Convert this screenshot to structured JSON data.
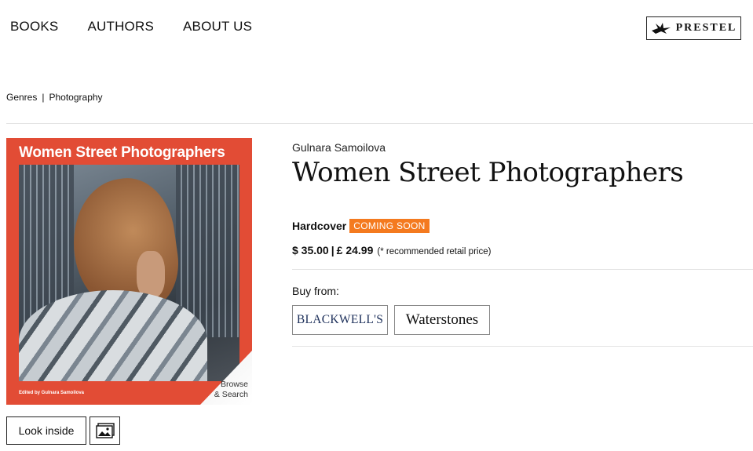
{
  "nav": {
    "items": [
      {
        "label": "BOOKS"
      },
      {
        "label": "AUTHORS"
      },
      {
        "label": "ABOUT US"
      }
    ],
    "logo_text": "PRESTEL",
    "logo_icon": "bird-icon"
  },
  "breadcrumb": {
    "items": [
      "Genres",
      "Photography"
    ],
    "separator": "|"
  },
  "cover": {
    "title": "Women Street Photographers",
    "editor_line": "Edited by Gulnara Samoilova",
    "curl_text_line1": "Browse",
    "curl_text_line2": "& Search",
    "background_color": "#e24c35"
  },
  "book": {
    "author": "Gulnara Samoilova",
    "title": "Women Street Photographers",
    "format": "Hardcover",
    "badge": "COMING SOON",
    "badge_color": "#f47a1f",
    "price_usd": "$ 35.00",
    "price_separator": "|",
    "price_gbp": "£ 24.99",
    "price_note": "(* recommended retail price)"
  },
  "buy": {
    "label": "Buy from:",
    "retailers": [
      {
        "name": "BLACKWELL'S"
      },
      {
        "name": "Waterstones"
      }
    ]
  },
  "actions": {
    "look_inside": "Look inside",
    "gallery_icon": "image-gallery-icon"
  }
}
